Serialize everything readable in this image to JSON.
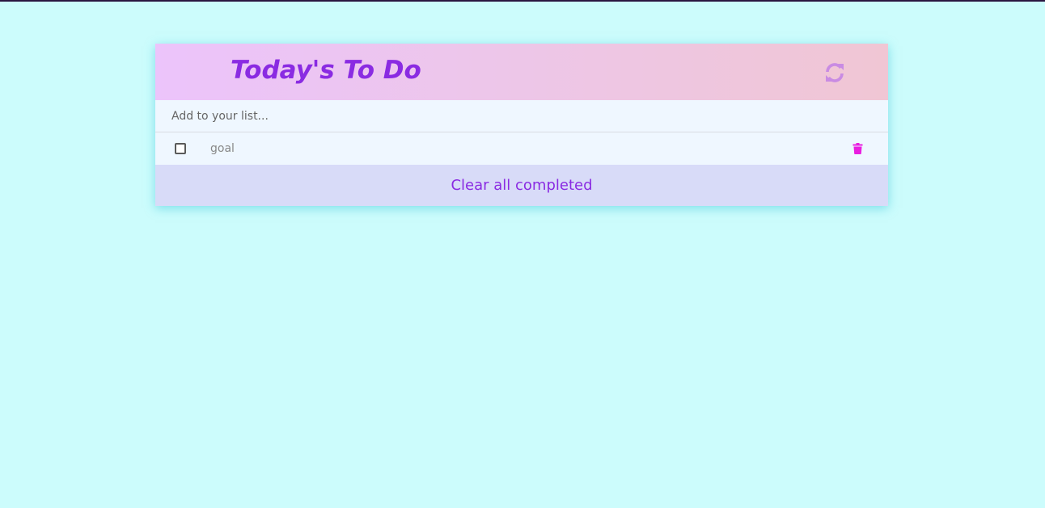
{
  "header": {
    "title": "Today's To Do",
    "refresh_icon": "refresh-icon"
  },
  "add_input": {
    "placeholder": "Add to your list...",
    "value": ""
  },
  "todos": [
    {
      "text": "goal",
      "completed": false,
      "delete_icon": "trash-icon"
    }
  ],
  "footer": {
    "clear_label": "Clear all completed"
  },
  "colors": {
    "background": "#ccfcfc",
    "accent": "#8a2be2",
    "trash": "#e91ee0",
    "refresh": "#c98be3"
  }
}
